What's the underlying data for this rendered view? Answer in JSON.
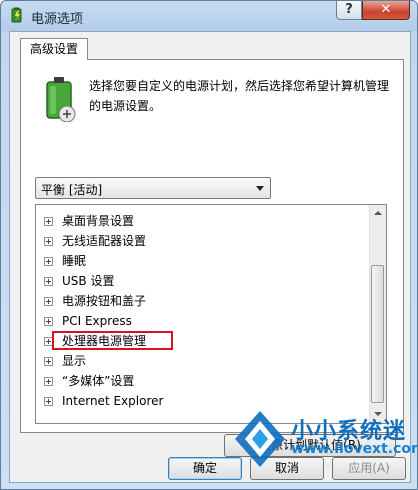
{
  "window": {
    "title": "电源选项",
    "help_label": "?",
    "close_label": "✕"
  },
  "tab": {
    "label": "高级设置"
  },
  "intro": {
    "text": "选择您要自定义的电源计划，然后选择您希望计算机管理的电源设置。"
  },
  "plan_select": {
    "value": "平衡 [活动]"
  },
  "tree": {
    "items": [
      {
        "label": "桌面背景设置"
      },
      {
        "label": "无线适配器设置"
      },
      {
        "label": "睡眠"
      },
      {
        "label": "USB 设置"
      },
      {
        "label": "电源按钮和盖子"
      },
      {
        "label": "PCI Express"
      },
      {
        "label": "处理器电源管理"
      },
      {
        "label": "显示"
      },
      {
        "label": "“多媒体”设置"
      },
      {
        "label": "Internet Explorer"
      }
    ],
    "highlighted_item": "处理器电源管理"
  },
  "buttons": {
    "restore_label": "还原计划默认值(R)",
    "ok_label": "确定",
    "cancel_label": "取消",
    "apply_label": "应用(A)"
  },
  "watermark": {
    "name": "小小系统迷",
    "url": "www.ilovext.com"
  },
  "colors": {
    "highlight_border": "#d9121c",
    "close_button": "#c8452f",
    "watermark_blue": "#0e6fc0"
  }
}
